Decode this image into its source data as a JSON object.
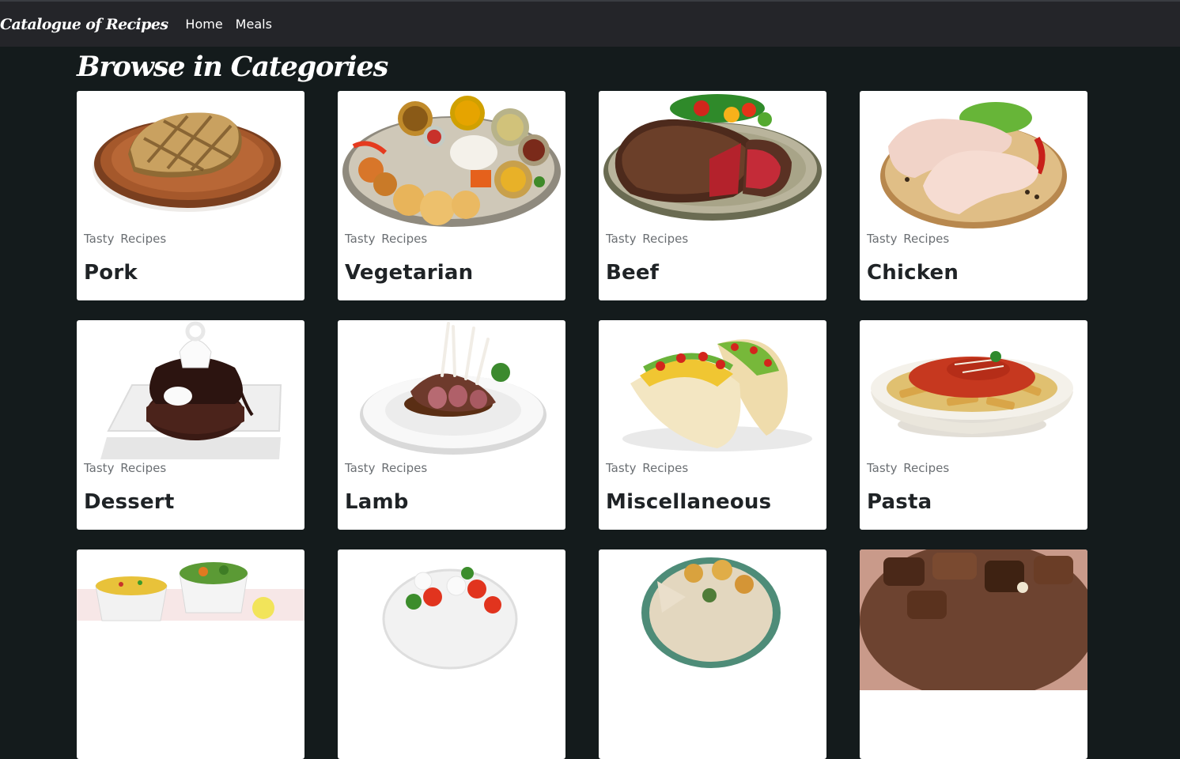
{
  "navbar": {
    "brand": "Catalogue of Recipes",
    "links": [
      "Home",
      "Meals"
    ]
  },
  "page": {
    "title": "Browse in Categories"
  },
  "cards": [
    {
      "subtitle": "Tasty Recipes",
      "title": "Pork",
      "image": "pork-steak-image"
    },
    {
      "subtitle": "Tasty Recipes",
      "title": "Vegetarian",
      "image": "vegetarian-thali-image"
    },
    {
      "subtitle": "Tasty Recipes",
      "title": "Beef",
      "image": "beef-steak-image"
    },
    {
      "subtitle": "Tasty Recipes",
      "title": "Chicken",
      "image": "raw-chicken-image"
    },
    {
      "subtitle": "Tasty Recipes",
      "title": "Dessert",
      "image": "chocolate-dessert-image"
    },
    {
      "subtitle": "Tasty Recipes",
      "title": "Lamb",
      "image": "lamb-rack-image"
    },
    {
      "subtitle": "Tasty Recipes",
      "title": "Miscellaneous",
      "image": "tacos-image"
    },
    {
      "subtitle": "Tasty Recipes",
      "title": "Pasta",
      "image": "penne-pasta-image"
    },
    {
      "image": "side-dishes-image"
    },
    {
      "image": "caprese-salad-image"
    },
    {
      "image": "grilled-platter-image"
    },
    {
      "image": "stewed-meat-image"
    }
  ]
}
